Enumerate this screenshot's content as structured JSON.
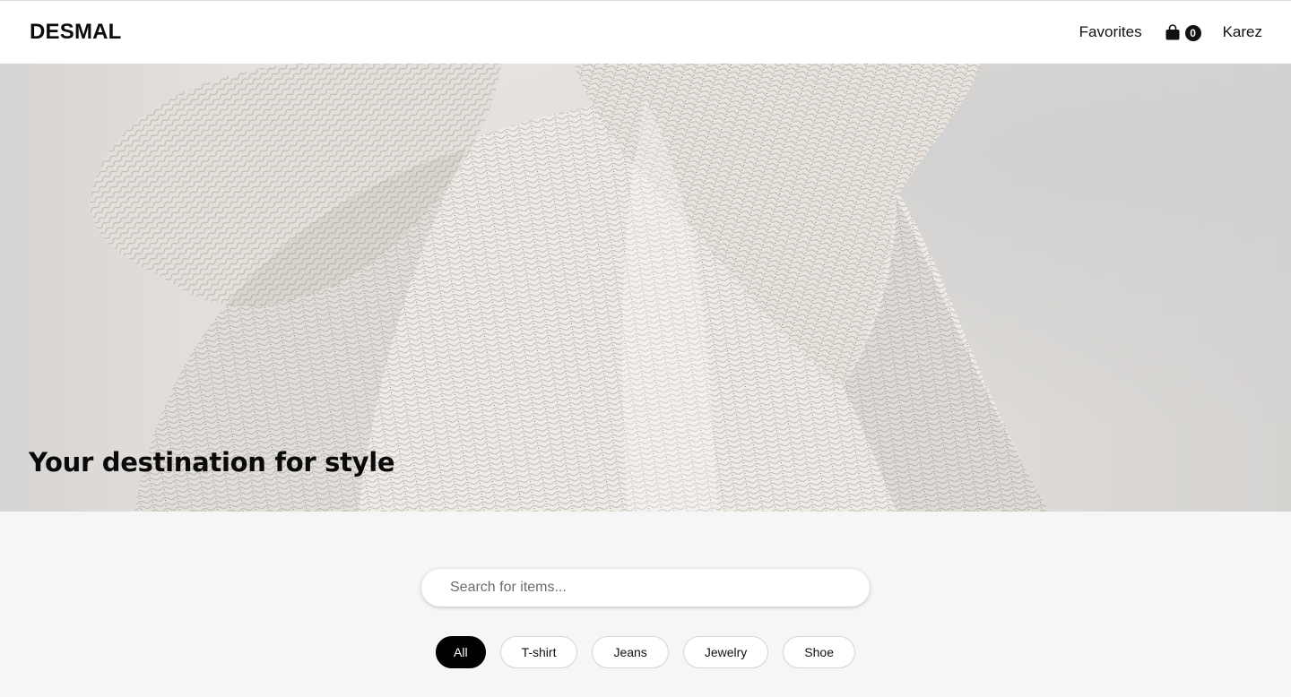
{
  "header": {
    "brand": "DESMAL",
    "nav": {
      "favorites_label": "Favorites",
      "cart_count": "0",
      "user_label": "Karez"
    }
  },
  "hero": {
    "title": "Your destination for style",
    "image_icon": "knit-sweater-image"
  },
  "search": {
    "placeholder": "Search for items...",
    "value": ""
  },
  "filters": {
    "items": [
      {
        "label": "All",
        "active": true
      },
      {
        "label": "T-shirt",
        "active": false
      },
      {
        "label": "Jeans",
        "active": false
      },
      {
        "label": "Jewelry",
        "active": false
      },
      {
        "label": "Shoe",
        "active": false
      }
    ]
  },
  "colors": {
    "accent": "#000000",
    "page_background": "#f6f6f6",
    "header_background": "#ffffff"
  }
}
